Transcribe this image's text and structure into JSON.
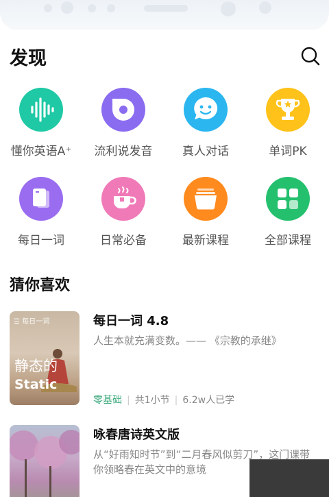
{
  "header": {
    "title": "发现"
  },
  "grid": [
    {
      "label": "懂你英语A⁺",
      "icon": "voice-wave-icon",
      "color": "#1fc9a5"
    },
    {
      "label": "流利说发音",
      "icon": "speech-bubble-icon",
      "color": "#8a6cf0"
    },
    {
      "label": "真人对话",
      "icon": "smiley-chat-icon",
      "color": "#2bb6f0"
    },
    {
      "label": "单词PK",
      "icon": "trophy-icon",
      "color": "#ffc21a"
    },
    {
      "label": "每日一词",
      "icon": "card-icon",
      "color": "#9a6cf0"
    },
    {
      "label": "日常必备",
      "icon": "cup-icon",
      "color": "#f07ab8"
    },
    {
      "label": "最新课程",
      "icon": "box-icon",
      "color": "#ff8a1e"
    },
    {
      "label": "全部课程",
      "icon": "grid-icon",
      "color": "#25c06e"
    }
  ],
  "section": {
    "title": "猜你喜欢"
  },
  "cards": [
    {
      "title": "每日一词 4.8",
      "desc": "人生本就充满变数。—— 《宗教的承继》",
      "thumb_tag": "☰ 每日一词",
      "thumb_cn": "静态的",
      "thumb_en": "Static",
      "level": "零基础",
      "sections": "共1小节",
      "learners": "6.2w人已学"
    },
    {
      "title": "咏春唐诗英文版",
      "desc": "从“好雨知时节”到“二月春风似剪刀”，这门课带你领略春在英文中的意境"
    }
  ]
}
